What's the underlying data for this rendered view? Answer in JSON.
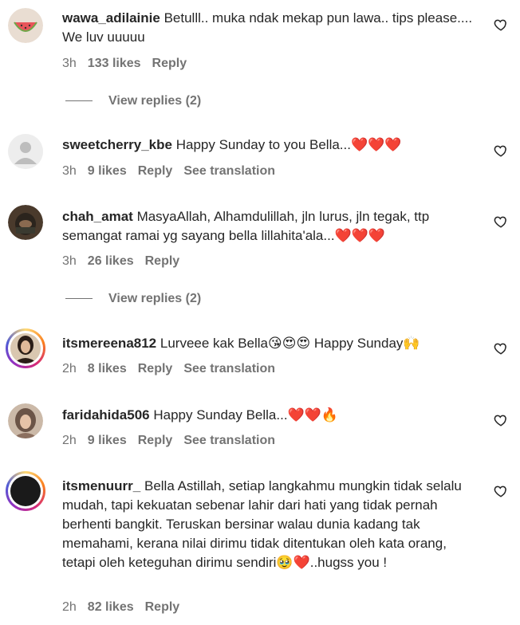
{
  "colors": {
    "text": "#262626",
    "meta": "#737373",
    "heart_emoji": "#e0245e"
  },
  "comments": [
    {
      "username": "wawa_adilainie",
      "text": "Betulll.. muka ndak mekap pun lawa.. tips please.... We luv uuuuu",
      "time": "3h",
      "likes": "133 likes",
      "reply": "Reply",
      "translation": "",
      "view_replies": "View replies (2)",
      "avatar": "watermelon-avatar"
    },
    {
      "username": "sweetcherry_kbe",
      "text": "Happy Sunday to you Bella...❤️❤️❤️",
      "time": "3h",
      "likes": "9 likes",
      "reply": "Reply",
      "translation": "See translation",
      "view_replies": "",
      "avatar": "default-avatar"
    },
    {
      "username": "chah_amat",
      "text": "MasyaAllah, Alhamdulillah, jln lurus, jln tegak, ttp semangat ramai yg sayang bella lillahita'ala...❤️❤️❤️",
      "time": "3h",
      "likes": "26 likes",
      "reply": "Reply",
      "translation": "",
      "view_replies": "View replies (2)",
      "avatar": "hijab-avatar"
    },
    {
      "username": "itsmereena812",
      "text": "Lurveee kak Bella😘😍😍 Happy Sunday🙌",
      "time": "2h",
      "likes": "8 likes",
      "reply": "Reply",
      "translation": "See translation",
      "view_replies": "",
      "avatar": "woman-avatar"
    },
    {
      "username": "faridahida506",
      "text": "Happy Sunday Bella...❤️❤️🔥",
      "time": "2h",
      "likes": "9 likes",
      "reply": "Reply",
      "translation": "See translation",
      "view_replies": "",
      "avatar": "hijab-woman-avatar"
    },
    {
      "username": "itsmenuurr_",
      "text": "Bella Astillah, setiap langkahmu mungkin tidak selalu mudah, tapi kekuatan sebenar lahir dari hati yang tidak pernah berhenti bangkit. Teruskan bersinar walau dunia kadang tak memahami, kerana nilai dirimu tidak ditentukan oleh kata orang, tetapi oleh keteguhan dirimu sendiri🥹❤️..hugss you !",
      "time": "2h",
      "likes": "82 likes",
      "reply": "Reply",
      "translation": "",
      "view_replies": "",
      "avatar": "dark-avatar"
    }
  ]
}
